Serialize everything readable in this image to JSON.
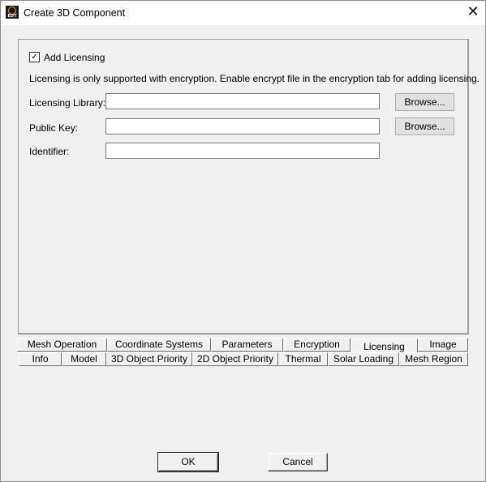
{
  "window": {
    "title": "Create 3D Component",
    "icon": "edt-app-icon",
    "icon_text": "EDT",
    "close_glyph": "✕"
  },
  "licensing": {
    "add_licensing_label": "Add Licensing",
    "add_licensing_checked": true,
    "checkmark": "✓",
    "info_text": "Licensing is only supported with encryption. Enable encrypt file in the encryption tab for adding licensing.",
    "fields": [
      {
        "label": "Licensing Library:",
        "value": "",
        "browse": "Browse..."
      },
      {
        "label": "Public Key:",
        "value": "",
        "browse": "Browse..."
      },
      {
        "label": "Identifier:",
        "value": ""
      }
    ]
  },
  "tabs": {
    "row1": [
      "Mesh Operation",
      "Coordinate Systems",
      "Parameters",
      "Encryption",
      "Licensing",
      "Image"
    ],
    "row2": [
      "Info",
      "Model",
      "3D Object Priority",
      "2D Object Priority",
      "Thermal",
      "Solar Loading",
      "Mesh Region"
    ],
    "active": "Licensing"
  },
  "footer": {
    "ok_label": "OK",
    "cancel_label": "Cancel"
  }
}
